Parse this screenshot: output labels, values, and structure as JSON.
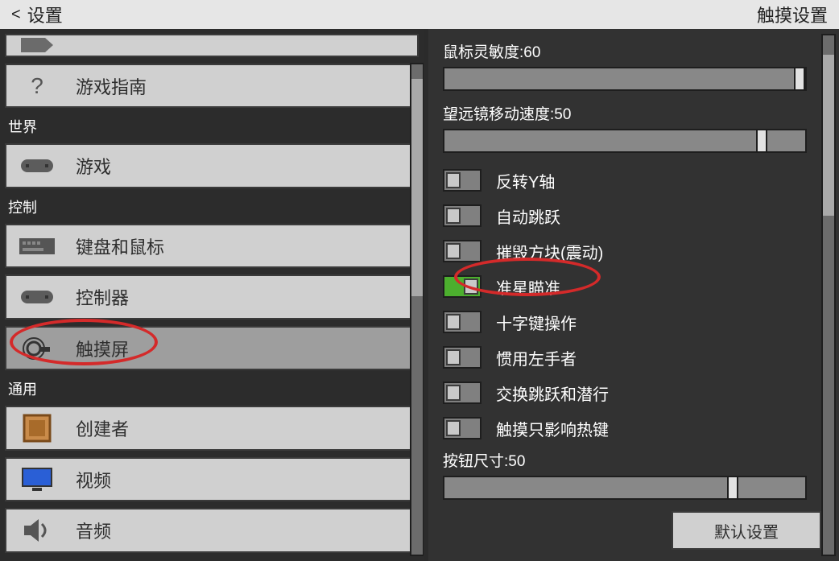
{
  "topbar": {
    "back": "<",
    "title": "设置",
    "right_title": "触摸设置"
  },
  "left": {
    "sections": [
      {
        "label": "",
        "items": [
          {
            "icon": "question",
            "label": "游戏指南"
          }
        ]
      },
      {
        "label": "世界",
        "items": [
          {
            "icon": "gamepad",
            "label": "游戏"
          }
        ]
      },
      {
        "label": "控制",
        "items": [
          {
            "icon": "keyboard",
            "label": "键盘和鼠标"
          },
          {
            "icon": "gamepad",
            "label": "控制器"
          },
          {
            "icon": "touch",
            "label": "触摸屏",
            "selected": true
          }
        ]
      },
      {
        "label": "通用",
        "items": [
          {
            "icon": "creator",
            "label": "创建者"
          },
          {
            "icon": "monitor",
            "label": "视频"
          },
          {
            "icon": "speaker",
            "label": "音频"
          }
        ]
      }
    ]
  },
  "right": {
    "sliders": [
      {
        "label": "鼠标灵敏度:60",
        "pos": 1.0
      },
      {
        "label": "望远镜移动速度:50",
        "pos": 0.88
      }
    ],
    "toggles": [
      {
        "label": "反转Y轴",
        "on": false
      },
      {
        "label": "自动跳跃",
        "on": false
      },
      {
        "label": "摧毁方块(震动)",
        "on": false
      },
      {
        "label": "准星瞄准",
        "on": true
      },
      {
        "label": "十字键操作",
        "on": false
      },
      {
        "label": "惯用左手者",
        "on": false
      },
      {
        "label": "交换跳跃和潜行",
        "on": false
      },
      {
        "label": "触摸只影响热键",
        "on": false
      }
    ],
    "slider2": {
      "label": "按钮尺寸:50",
      "pos": 0.8
    },
    "default_button": "默认设置"
  }
}
